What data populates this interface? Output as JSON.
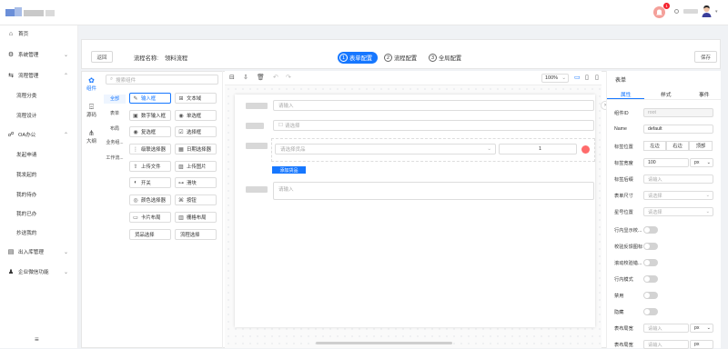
{
  "header": {
    "notification_count": "1",
    "avatar_icon": "avatar-icon"
  },
  "sidebar": {
    "items": [
      {
        "label": "首页",
        "icon": "home-icon",
        "expandable": false
      },
      {
        "label": "系统管理",
        "icon": "gear-icon",
        "expandable": true
      },
      {
        "label": "流程管理",
        "icon": "flow-icon",
        "expandable": true,
        "expanded": true
      },
      {
        "label": "流程分类",
        "sub": true
      },
      {
        "label": "流程设计",
        "sub": true
      },
      {
        "label": "OA办公",
        "icon": "office-icon",
        "expandable": true,
        "expanded": true
      },
      {
        "label": "发起申请",
        "sub": true
      },
      {
        "label": "我发起的",
        "sub": true
      },
      {
        "label": "我的待办",
        "sub": true
      },
      {
        "label": "我的已办",
        "sub": true
      },
      {
        "label": "抄送我的",
        "sub": true
      },
      {
        "label": "出入库管理",
        "icon": "warehouse-icon",
        "expandable": true
      },
      {
        "label": "企业微信功能",
        "icon": "wechat-icon",
        "expandable": true
      }
    ],
    "collapse_icon": "menu-icon"
  },
  "page": {
    "back_label": "返回",
    "process_name_label": "流程名称:",
    "process_name": "领料流程",
    "save_label": "保存",
    "steps": [
      {
        "num": "1",
        "label": "表单配置",
        "active": true
      },
      {
        "num": "2",
        "label": "流程配置",
        "active": false
      },
      {
        "num": "3",
        "label": "全局配置",
        "active": false
      }
    ]
  },
  "left_tabs": [
    {
      "label": "组件",
      "icon": "component-icon",
      "active": true
    },
    {
      "label": "源码",
      "icon": "code-icon",
      "active": false
    },
    {
      "label": "大纲",
      "icon": "outline-icon",
      "active": false
    }
  ],
  "palette": {
    "search_placeholder": "搜索组件",
    "categories": [
      {
        "label": "全部",
        "active": true
      },
      {
        "label": "表单",
        "active": false
      },
      {
        "label": "布局",
        "active": false
      },
      {
        "label": "业务组...",
        "active": false
      },
      {
        "label": "工作流...",
        "active": false
      }
    ],
    "components": [
      {
        "label": "输入框",
        "icon": "edit-icon",
        "active": true
      },
      {
        "label": "文本域",
        "icon": "textarea-icon"
      },
      {
        "label": "数字输入框",
        "icon": "number-icon"
      },
      {
        "label": "单选框",
        "icon": "radio-icon"
      },
      {
        "label": "复选框",
        "icon": "checkbox-icon"
      },
      {
        "label": "选择框",
        "icon": "select-icon"
      },
      {
        "label": "级联选择器",
        "icon": "cascader-icon"
      },
      {
        "label": "日期选择器",
        "icon": "calendar-icon"
      },
      {
        "label": "上传文件",
        "icon": "upload-icon"
      },
      {
        "label": "上传图片",
        "icon": "image-icon"
      },
      {
        "label": "开关",
        "icon": "switch-icon"
      },
      {
        "label": "滑块",
        "icon": "slider-icon"
      },
      {
        "label": "颜色选择器",
        "icon": "palette-icon"
      },
      {
        "label": "按钮",
        "icon": "button-icon"
      },
      {
        "label": "卡片布局",
        "icon": "card-icon"
      },
      {
        "label": "栅格布局",
        "icon": "grid-icon"
      },
      {
        "label": "货品选择",
        "icon": ""
      },
      {
        "label": "流程选择",
        "icon": ""
      }
    ]
  },
  "canvas": {
    "zoom": "100%",
    "fields": [
      {
        "type": "input",
        "placeholder": "请输入"
      },
      {
        "type": "select",
        "placeholder": "请选择"
      },
      {
        "type": "goods",
        "placeholder": "请选择货品",
        "quantity": "1"
      },
      {
        "type": "textarea",
        "placeholder": "请输入"
      }
    ],
    "add_goods_label": "添加货品"
  },
  "right_panel": {
    "title": "表单",
    "tabs": [
      {
        "label": "属性",
        "active": true
      },
      {
        "label": "样式",
        "active": false
      },
      {
        "label": "事件",
        "active": false
      }
    ],
    "props": [
      {
        "label": "组件ID",
        "value": "root",
        "kind": "input-disabled"
      },
      {
        "label": "Name",
        "value": "default",
        "kind": "input"
      },
      {
        "label": "标签位置",
        "kind": "radio",
        "options": [
          "左边",
          "右边",
          "顶部"
        ]
      },
      {
        "label": "标签宽度",
        "value": "100",
        "unit": "px",
        "kind": "unit"
      },
      {
        "label": "标签后缀",
        "placeholder": "请输入",
        "kind": "input"
      },
      {
        "label": "表单尺寸",
        "placeholder": "请选择",
        "kind": "select"
      },
      {
        "label": "星号位置",
        "placeholder": "请选择",
        "kind": "select"
      },
      {
        "label": "行内显示校...",
        "kind": "toggle"
      },
      {
        "label": "校验反馈图标",
        "kind": "toggle"
      },
      {
        "label": "滚动校验错...",
        "kind": "toggle"
      },
      {
        "label": "行内模式",
        "kind": "toggle"
      },
      {
        "label": "禁用",
        "kind": "toggle"
      },
      {
        "label": "隐藏",
        "kind": "toggle"
      },
      {
        "label": "表布局宽",
        "placeholder": "请输入",
        "unit": "px",
        "kind": "unit"
      },
      {
        "label": "表布局宽",
        "placeholder": "请输入",
        "unit": "px",
        "kind": "unit"
      }
    ]
  },
  "colors": {
    "accent": "#1677ff",
    "danger": "#ff6b6b"
  }
}
